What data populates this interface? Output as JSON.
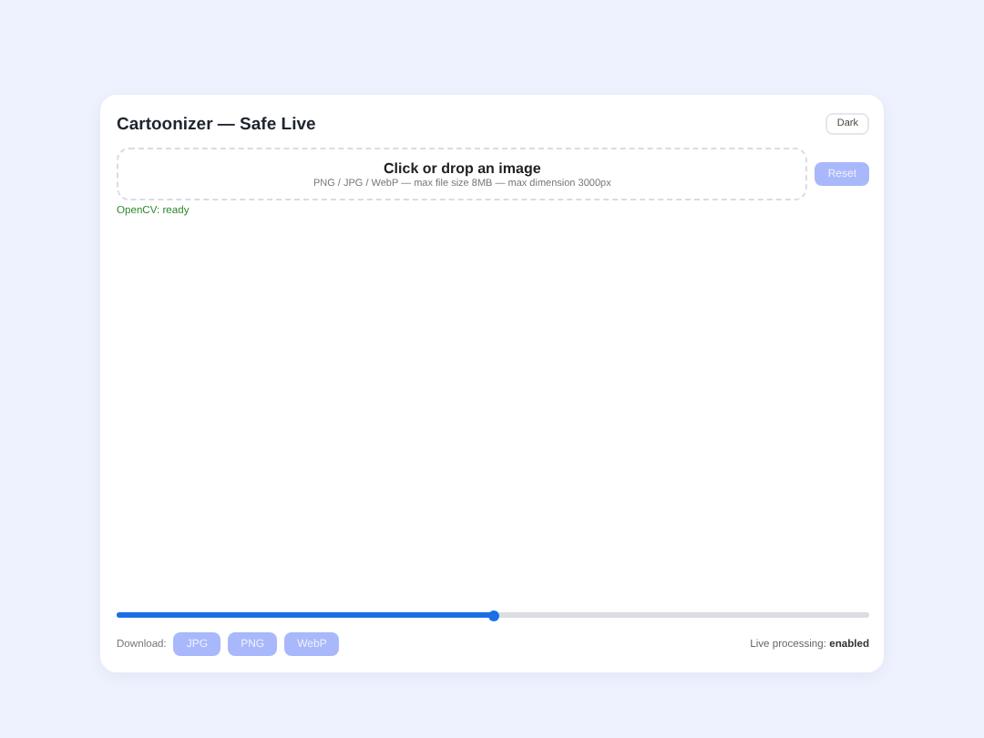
{
  "header": {
    "title": "Cartoonizer — Safe Live",
    "theme_button": "Dark"
  },
  "dropzone": {
    "title": "Click or drop an image",
    "hint": "PNG / JPG / WebP — max file size 8MB — max dimension 3000px"
  },
  "reset_button": {
    "label": "Reset",
    "disabled": true
  },
  "status": "OpenCV: ready",
  "slider": {
    "level": 0.5
  },
  "download": {
    "label": "Download:",
    "buttons": [
      {
        "label": "JPG",
        "disabled": true
      },
      {
        "label": "PNG",
        "disabled": true
      },
      {
        "label": "WebP",
        "disabled": true
      }
    ]
  },
  "live_status": "Live processing: **enabled**"
}
